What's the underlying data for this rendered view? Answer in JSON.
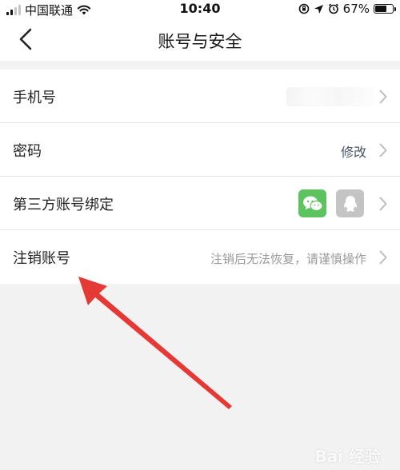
{
  "status_bar": {
    "carrier": "中国联通",
    "time": "10:40",
    "battery_percent": "67%",
    "icons": [
      "signal-icon",
      "wifi-icon",
      "lock-rotation-icon",
      "location-icon",
      "alarm-icon",
      "battery-icon"
    ]
  },
  "nav": {
    "title": "账号与安全",
    "back_icon": "back-chevron-icon"
  },
  "rows": [
    {
      "label": "手机号",
      "value": ""
    },
    {
      "label": "密码",
      "value": "修改"
    },
    {
      "label": "第三方账号绑定",
      "icons": [
        "wechat-icon",
        "qq-icon"
      ]
    },
    {
      "label": "注销账号",
      "hint": "注销后无法恢复，请谨慎操作"
    }
  ],
  "annotation": {
    "arrow_color": "#e53935"
  },
  "watermark": {
    "text": "Bai 经验"
  },
  "colors": {
    "wechat": "#5cc35f",
    "qq_disabled": "#c4c4c4",
    "background": "#f2f2f2"
  }
}
